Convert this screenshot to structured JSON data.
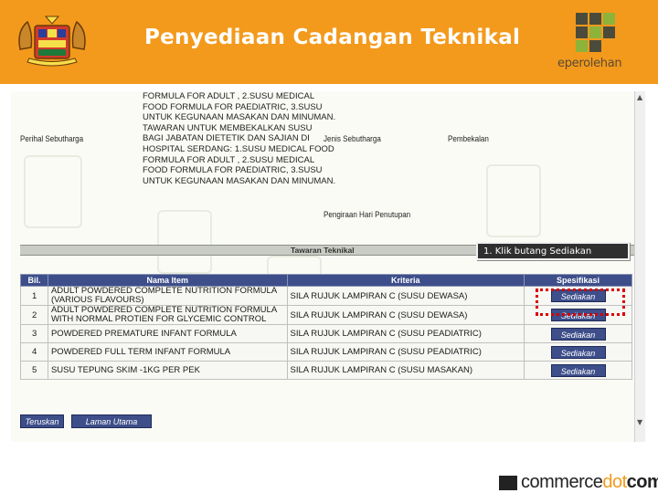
{
  "slide": {
    "title": "Penyediaan Cadangan Teknikal",
    "logo_text": "eperolehan",
    "footer_brand_1": "commerce",
    "footer_brand_2": "dot",
    "footer_brand_3": "com"
  },
  "form": {
    "description_lines": [
      "FORMULA FOR ADULT , 2.SUSU MEDICAL",
      "FOOD FORMULA FOR PAEDIATRIC, 3.SUSU",
      "UNTUK KEGUNAAN MASAKAN DAN MINUMAN.",
      "TAWARAN UNTUK MEMBEKALKAN SUSU",
      "BAGI JABATAN DIETETIK DAN SAJIAN DI",
      "HOSPITAL SERDANG: 1.SUSU MEDICAL FOOD",
      "FORMULA FOR ADULT , 2.SUSU MEDICAL",
      "FOOD FORMULA FOR PAEDIATRIC, 3.SUSU",
      "UNTUK KEGUNAAN MASAKAN DAN MINUMAN."
    ],
    "perihal_label": "Perihal Sebutharga",
    "jenis_label": "Jenis Sebutharga",
    "pembekalan_label": "Pembekalan",
    "pengiraan_label": "Pengiraan Hari Penutupan"
  },
  "section": {
    "title": "Tawaran Teknikal",
    "tooltip": "1. Klik butang Sediakan"
  },
  "table": {
    "headers": [
      "Bil.",
      "Nama Item",
      "Kriteria",
      "Spesifikasi"
    ],
    "rows": [
      {
        "no": "1",
        "item": "ADULT POWDERED COMPLETE NUTRITION FORMULA (VARIOUS FLAVOURS)",
        "kriteria": "SILA RUJUK LAMPIRAN C (SUSU DEWASA)",
        "action": "Sediakan"
      },
      {
        "no": "2",
        "item": "ADULT POWDERED COMPLETE NUTRITION FORMULA WITH NORMAL PROTIEN FOR GLYCEMIC CONTROL",
        "kriteria": "SILA RUJUK LAMPIRAN C (SUSU DEWASA)",
        "action": "Sediakan"
      },
      {
        "no": "3",
        "item": "POWDERED PREMATURE INFANT FORMULA",
        "kriteria": "SILA RUJUK LAMPIRAN C (SUSU PEADIATRIC)",
        "action": "Sediakan"
      },
      {
        "no": "4",
        "item": "POWDERED FULL TERM INFANT FORMULA",
        "kriteria": "SILA RUJUK LAMPIRAN C (SUSU PEADIATRIC)",
        "action": "Sediakan"
      },
      {
        "no": "5",
        "item": "SUSU TEPUNG SKIM -1KG PER PEK",
        "kriteria": "SILA RUJUK LAMPIRAN C (SUSU MASAKAN)",
        "action": "Sediakan"
      }
    ]
  },
  "buttons": {
    "teruskan": "Teruskan",
    "laman_utama": "Laman Utama"
  },
  "colors": {
    "header_orange": "#f39a1c",
    "table_header_blue": "#3d4e8a",
    "highlight_red": "#d90000"
  }
}
